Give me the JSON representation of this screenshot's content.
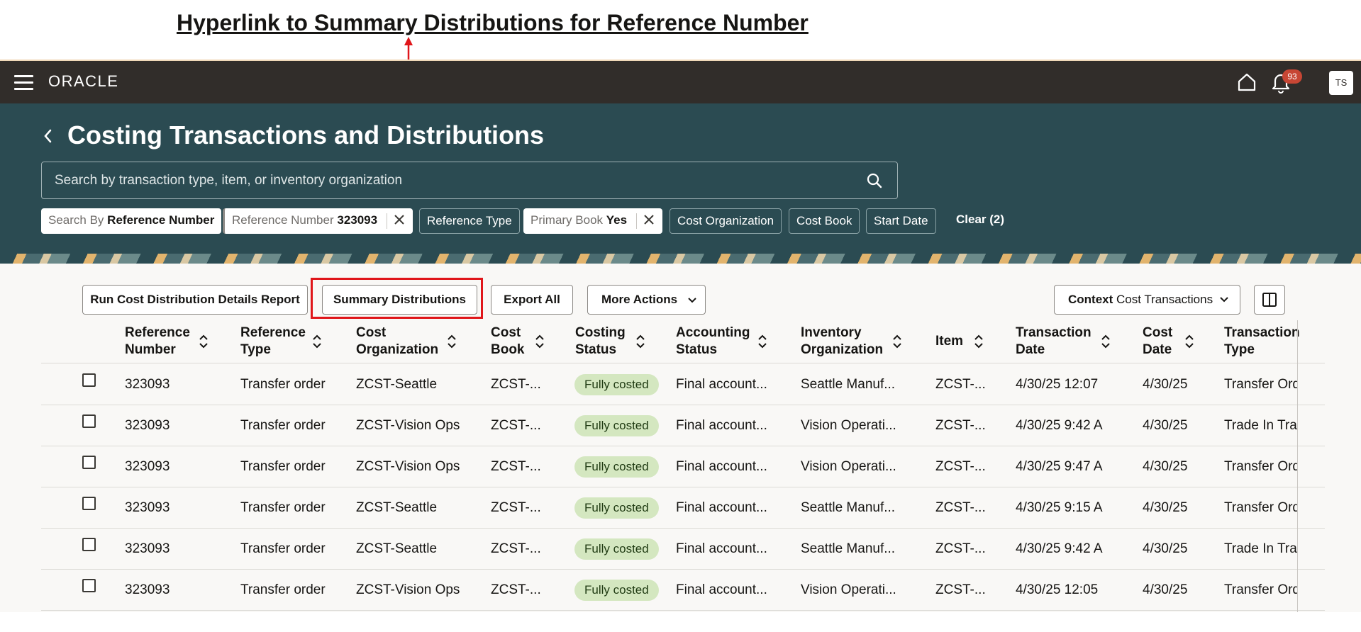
{
  "annotation": {
    "title": "Hyperlink to Summary Distributions for Reference Number"
  },
  "app_header": {
    "logo": "ORACLE",
    "notification_count": "93",
    "avatar_initials": "TS"
  },
  "page": {
    "title": "Costing Transactions and Distributions",
    "search_placeholder": "Search by transaction type, item, or inventory organization"
  },
  "filters": {
    "search_by": {
      "label": "Search By",
      "value": "Reference Number"
    },
    "reference_number": {
      "label": "Reference Number",
      "value": "323093"
    },
    "reference_type": "Reference Type",
    "primary_book": {
      "label": "Primary Book",
      "value": "Yes"
    },
    "cost_organization": "Cost Organization",
    "cost_book": "Cost Book",
    "start_date": "Start Date",
    "clear": "Clear (2)"
  },
  "toolbar": {
    "run_report": "Run Cost Distribution Details Report",
    "summary_distributions": "Summary Distributions",
    "export_all": "Export All",
    "more_actions": "More Actions",
    "context_label": "Context",
    "context_value": "Cost Transactions"
  },
  "table": {
    "headers": [
      [
        "Reference",
        "Number"
      ],
      [
        "Reference",
        "Type"
      ],
      [
        "Cost",
        "Organization"
      ],
      [
        "Cost",
        "Book"
      ],
      [
        "Costing",
        "Status"
      ],
      [
        "Accounting",
        "Status"
      ],
      [
        "Inventory",
        "Organization"
      ],
      [
        "Item",
        ""
      ],
      [
        "Transaction",
        "Date"
      ],
      [
        "Cost",
        "Date"
      ],
      [
        "Transaction",
        "Type"
      ]
    ],
    "rows": [
      [
        "323093",
        "Transfer order",
        "ZCST-Seattle",
        "ZCST-...",
        "Fully costed",
        "Final account...",
        "Seattle Manuf...",
        "ZCST-...",
        "4/30/25 12:07",
        "4/30/25",
        "Transfer Ord"
      ],
      [
        "323093",
        "Transfer order",
        "ZCST-Vision Ops",
        "ZCST-...",
        "Fully costed",
        "Final account...",
        "Vision Operati...",
        "ZCST-...",
        "4/30/25 9:42 A",
        "4/30/25",
        "Trade In Tra"
      ],
      [
        "323093",
        "Transfer order",
        "ZCST-Vision Ops",
        "ZCST-...",
        "Fully costed",
        "Final account...",
        "Vision Operati...",
        "ZCST-...",
        "4/30/25 9:47 A",
        "4/30/25",
        "Transfer Ord"
      ],
      [
        "323093",
        "Transfer order",
        "ZCST-Seattle",
        "ZCST-...",
        "Fully costed",
        "Final account...",
        "Seattle Manuf...",
        "ZCST-...",
        "4/30/25 9:15 A",
        "4/30/25",
        "Transfer Ord"
      ],
      [
        "323093",
        "Transfer order",
        "ZCST-Seattle",
        "ZCST-...",
        "Fully costed",
        "Final account...",
        "Seattle Manuf...",
        "ZCST-...",
        "4/30/25 9:42 A",
        "4/30/25",
        "Trade In Tra"
      ],
      [
        "323093",
        "Transfer order",
        "ZCST-Vision Ops",
        "ZCST-...",
        "Fully costed",
        "Final account...",
        "Vision Operati...",
        "ZCST-...",
        "4/30/25 12:05",
        "4/30/25",
        "Transfer Ord"
      ]
    ]
  },
  "colors": {
    "header_bg": "#312d2a",
    "page_header_bg": "#2b4b52",
    "badge_bg": "#d4e7c0",
    "highlight": "#e0161a"
  }
}
